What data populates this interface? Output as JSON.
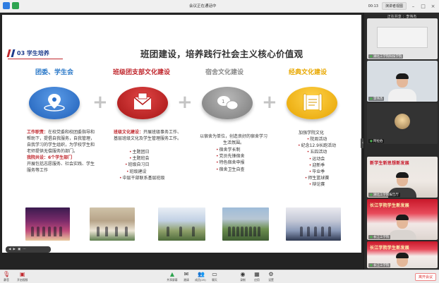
{
  "window": {
    "title": "会议正在通话中",
    "time": "00:13",
    "layout_button": "演讲者视图",
    "min_icon": "minimize-icon",
    "max_icon": "maximize-icon",
    "close_icon": "close-icon"
  },
  "slide": {
    "section_label": "03  学生培养",
    "title": "班团建设，培养践行社会主义核心价值观",
    "columns": [
      {
        "title": "团委、学生会",
        "color": "#2a78c8",
        "icon": "location-pin-icon"
      },
      {
        "title": "班级团支部文化建设",
        "color": "#c0272d",
        "icon": "envelope-icon"
      },
      {
        "title": "宿舍文化建设",
        "color": "#8a8a8a",
        "icon": "chat-bubbles-icon"
      },
      {
        "title": "经典文化建设",
        "color": "#e8a800",
        "icon": "scroll-icon"
      }
    ],
    "col1": {
      "label": "工作职责：",
      "text1": "在校党委和校团委指导和帮助下，提倡自我服务，自我管理，自我学习的学生组织，为学校学生和老师提供无偿服务的部门。",
      "label2": "我院共设：6个学生部门",
      "text2": "开展包括志愿服务、社会实践、学生服务等工作"
    },
    "col2": {
      "label": "班级文化建设：",
      "text1": "开展班级事务工作、基层班级文化及学生管理服务工作。",
      "items": [
        "主题团日",
        "主题班会",
        "班级自习日",
        "班级建设",
        "中层干部联系基层班级"
      ]
    },
    "col3": {
      "text1": "以宿舍为单位，创造良好的宿舍学习生活氛围。",
      "items": [
        "宿舍学长制",
        "党员先锋宿舍",
        "特色宿舍申报",
        "宿舍卫生自查"
      ]
    },
    "col4": {
      "text1": "加强学院文化",
      "items": [
        "院周活动",
        "纪念12.9长跑活动",
        "五四活动",
        "运动会",
        "迎新季",
        "毕业季",
        "师生篮球赛",
        "辩论赛"
      ]
    },
    "controls": [
      "◀",
      "▶",
      "▣",
      "⋯"
    ]
  },
  "participants": {
    "header": "正在共享  ：李伟杰",
    "tiles": [
      {
        "name": "湖北工学院科技学院"
      },
      {
        "name": "李伟杰"
      },
      {
        "name": "阿拉伯"
      },
      {
        "name": "湖北工学院报告厅",
        "banner": "新学生新思想新发展"
      },
      {
        "name": "长江工学院",
        "banner": "长江学院学生新发展"
      },
      {
        "name": "长江工学院",
        "banner": "长江学院学生新发展"
      }
    ]
  },
  "toolbar": {
    "left": [
      {
        "label": "静音",
        "icon": "mic-icon"
      },
      {
        "label": "开启视频",
        "icon": "video-icon"
      }
    ],
    "items": [
      {
        "label": "共享屏幕",
        "icon": "share-screen-icon"
      },
      {
        "label": "邀请",
        "icon": "invite-icon"
      },
      {
        "label": "成员(25)",
        "icon": "members-icon"
      },
      {
        "label": "聊天",
        "icon": "chat-icon"
      },
      {
        "label": "录制",
        "icon": "record-icon"
      },
      {
        "label": "应用",
        "icon": "apps-icon"
      },
      {
        "label": "设置",
        "icon": "settings-icon"
      }
    ],
    "exit": "离开会议"
  }
}
